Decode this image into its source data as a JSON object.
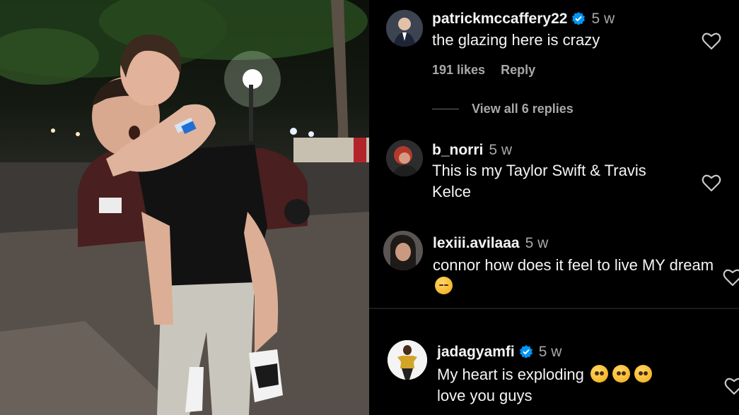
{
  "comments": [
    {
      "username": "patrickmccaffery22",
      "verified": true,
      "time": "5 w",
      "text": "the glazing here is crazy",
      "likes": "191 likes",
      "reply_label": "Reply",
      "view_replies": "View all 6 replies",
      "avatar_icon": "avatar-suit-man"
    },
    {
      "username": "b_norri",
      "verified": false,
      "time": "5 w",
      "text": "This is my Taylor Swift & Travis Kelce",
      "avatar_icon": "avatar-red-hair"
    },
    {
      "username": "lexiii.avilaaa",
      "verified": false,
      "time": "5 w",
      "text": "connor how does it feel to live MY dream",
      "emoji": "relieved-face-emoji",
      "avatar_icon": "avatar-selfie"
    },
    {
      "username": "jadagyamfi",
      "verified": true,
      "time": "5 w",
      "text_line1": "My heart is exploding",
      "text_line2": "love you guys",
      "emoji": "pleading-face-emoji",
      "avatar_icon": "avatar-gold-outfit"
    }
  ],
  "colors": {
    "background": "#000000",
    "text": "#f5f5f5",
    "muted": "#a8a8a8",
    "verified_blue": "#0095f6"
  }
}
